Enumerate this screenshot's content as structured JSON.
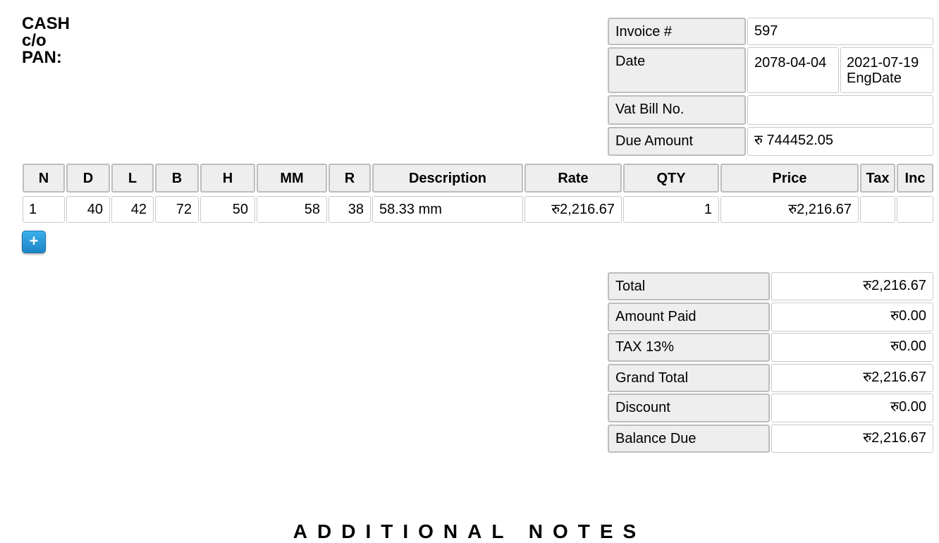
{
  "customer": {
    "name": "CASH",
    "care_of": "c/o",
    "pan": "PAN:"
  },
  "meta": {
    "invoice_label": "Invoice #",
    "invoice_value": "597",
    "date_label": "Date",
    "date_nepali": "2078-04-04",
    "date_english": "2021-07-19",
    "date_english_caption": "EngDate",
    "vat_label": "Vat Bill No.",
    "vat_value": "",
    "due_label": "Due Amount",
    "due_value": "रु 744452.05"
  },
  "items": {
    "columns": [
      "N",
      "D",
      "L",
      "B",
      "H",
      "MM",
      "R",
      "Description",
      "Rate",
      "QTY",
      "Price",
      "Tax",
      "Inc"
    ],
    "rows": [
      [
        "1",
        "40",
        "42",
        "72",
        "50",
        "58",
        "38",
        "58.33 mm",
        "रु2,216.67",
        "1",
        "रु2,216.67",
        "",
        ""
      ]
    ],
    "add_button": "+"
  },
  "totals": [
    {
      "label": "Total",
      "value": "रु2,216.67"
    },
    {
      "label": "Amount Paid",
      "value": "रु0.00"
    },
    {
      "label": "TAX 13%",
      "value": "रु0.00"
    },
    {
      "label": "Grand Total",
      "value": "रु2,216.67"
    },
    {
      "label": "Discount",
      "value": "रु0.00"
    },
    {
      "label": "Balance Due",
      "value": "रु2,216.67"
    }
  ],
  "notes_title": "ADDITIONAL NOTES",
  "colors": {
    "label_bg": "#eeeeee",
    "button_blue": "#1d83c8"
  }
}
